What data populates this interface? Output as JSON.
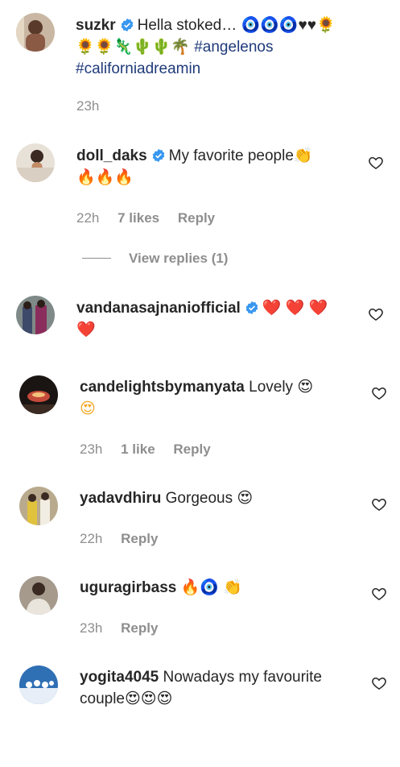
{
  "comments": [
    {
      "username": "suzkr",
      "text": "Hella stoked… 🧿🧿🧿♥♥🌻",
      "text_line2": "🌻🌻🦎🌵🌵🌴",
      "hashtag1": "#angelenos",
      "hashtag2": "#californiadreamin",
      "time": "23h"
    },
    {
      "username": "doll_daks",
      "text": "My favorite people👏",
      "text_line2": "🔥🔥🔥",
      "time": "22h",
      "likes": "7 likes",
      "reply": "Reply",
      "view_replies": "View replies (1)"
    },
    {
      "username": "vandanasajnaniofficial",
      "text": "❤️ ❤️ ❤️",
      "text_line2": "❤️"
    },
    {
      "username": "candelightsbymanyata",
      "text": "Lovely 😍",
      "text_line2": "😍",
      "time": "23h",
      "likes": "1 like",
      "reply": "Reply"
    },
    {
      "username": "yadavdhiru",
      "text": "Gorgeous 😍",
      "time": "22h",
      "reply": "Reply"
    },
    {
      "username": "uguragirbass",
      "text": "🔥🧿 👏",
      "time": "23h",
      "reply": "Reply"
    },
    {
      "username": "yogita4045",
      "text": "Nowadays my favourite",
      "text_line2": "couple😍😍😍"
    }
  ],
  "colors": {
    "text": "#262626",
    "meta": "#8e8e8e",
    "verified": "#3897f0",
    "hashtag": "#1f3a7a"
  },
  "icons": [
    "verified-badge-icon",
    "heart-outline-icon"
  ]
}
